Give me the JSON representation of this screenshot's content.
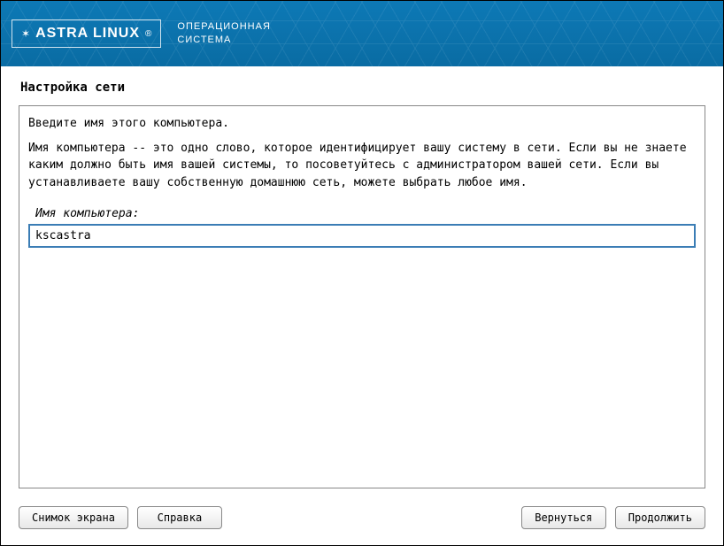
{
  "header": {
    "logo_text": "ASTRA LINUX",
    "subtitle_line1": "ОПЕРАЦИОННАЯ",
    "subtitle_line2": "СИСТЕМА"
  },
  "page": {
    "title": "Настройка сети"
  },
  "content": {
    "intro": "Введите имя этого компьютера.",
    "description": "Имя компьютера -- это одно слово, которое идентифицирует вашу систему в сети. Если вы не знаете каким должно быть имя вашей системы, то посоветуйтесь с администратором вашей сети. Если вы устанавливаете вашу собственную домашнюю сеть, можете выбрать любое имя.",
    "field_label": "Имя компьютера:",
    "hostname_value": "kscastra"
  },
  "buttons": {
    "screenshot": "Снимок экрана",
    "help": "Справка",
    "back": "Вернуться",
    "continue": "Продолжить"
  }
}
